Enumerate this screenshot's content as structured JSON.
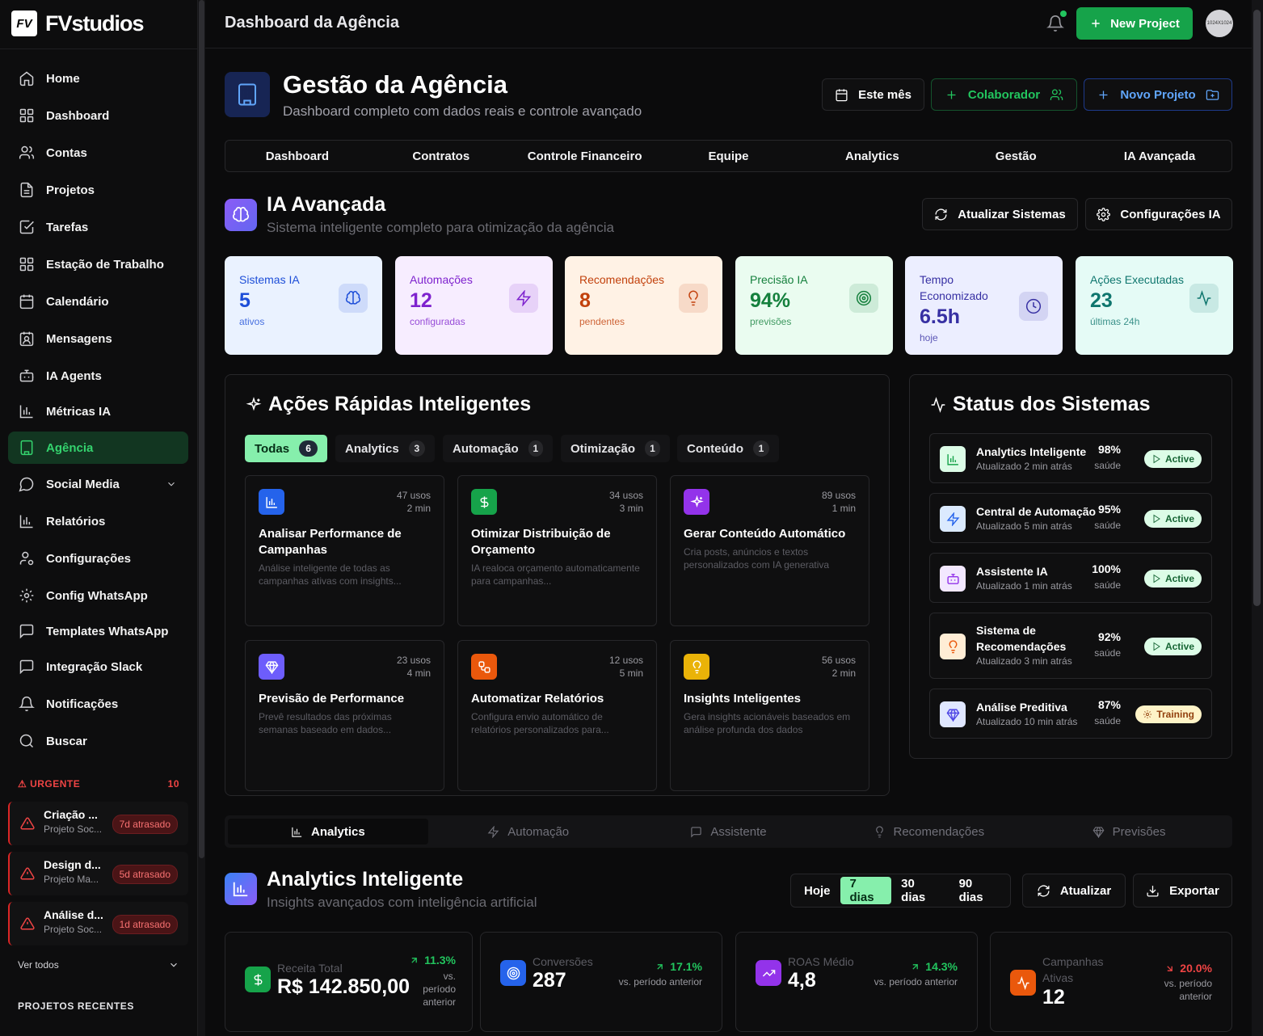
{
  "app": {
    "logo_mark": "FV",
    "logo_text": "FVstudios"
  },
  "nav": [
    {
      "label": "Home",
      "icon": "home-icon"
    },
    {
      "label": "Dashboard",
      "icon": "grid-icon"
    },
    {
      "label": "Contas",
      "icon": "users-icon"
    },
    {
      "label": "Projetos",
      "icon": "file-icon"
    },
    {
      "label": "Tarefas",
      "icon": "check-square-icon"
    },
    {
      "label": "Estação de Trabalho",
      "icon": "grid-icon"
    },
    {
      "label": "Calendário",
      "icon": "calendar-icon"
    },
    {
      "label": "Mensagens",
      "icon": "contact-icon"
    },
    {
      "label": "IA Agents",
      "icon": "bot-icon"
    },
    {
      "label": "Métricas IA",
      "icon": "bar-chart-icon"
    },
    {
      "label": "Agência",
      "icon": "building-icon",
      "active": true
    },
    {
      "label": "Social Media",
      "icon": "message-circle-icon"
    },
    {
      "label": "Relatórios",
      "icon": "bar-chart-icon"
    },
    {
      "label": "Configurações",
      "icon": "user-cog-icon"
    },
    {
      "label": "Config WhatsApp",
      "icon": "gear-icon"
    },
    {
      "label": "Templates WhatsApp",
      "icon": "message-square-icon"
    },
    {
      "label": "Integração Slack",
      "icon": "message-square-icon"
    },
    {
      "label": "Notificações",
      "icon": "bell-icon"
    },
    {
      "label": "Buscar",
      "icon": "search-icon"
    }
  ],
  "urgent": {
    "title": "URGENTE",
    "count": "10",
    "items": [
      {
        "title": "Criação ...",
        "sub": "Projeto Soc...",
        "badge": "7d atrasado"
      },
      {
        "title": "Design d...",
        "sub": "Projeto Ma...",
        "badge": "5d atrasado"
      },
      {
        "title": "Análise d...",
        "sub": "Projeto Soc...",
        "badge": "1d atrasado"
      }
    ],
    "see_all": "Ver todos"
  },
  "recent_projects": "PROJETOS RECENTES",
  "topbar": {
    "title": "Dashboard da Agência",
    "new_project": "New Project",
    "avatar": "1024X1024"
  },
  "page": {
    "title": "Gestão da Agência",
    "subtitle": "Dashboard completo com dados reais e controle avançado",
    "btn_month": "Este mês",
    "btn_colab": "Colaborador",
    "btn_novo": "Novo Projeto"
  },
  "tabs": [
    "Dashboard",
    "Contratos",
    "Controle Financeiro",
    "Equipe",
    "Analytics",
    "Gestão",
    "IA Avançada"
  ],
  "ia": {
    "title": "IA Avançada",
    "subtitle": "Sistema inteligente completo para otimização da agência",
    "btn_refresh": "Atualizar Sistemas",
    "btn_config": "Configurações IA"
  },
  "stats": [
    {
      "label": "Sistemas IA",
      "value": "5",
      "sub": "ativos",
      "color": "#1d4ed8",
      "bg": "#eaf2ff",
      "icon": "brain-icon"
    },
    {
      "label": "Automações",
      "value": "12",
      "sub": "configuradas",
      "color": "#7e22ce",
      "bg": "#f7edff",
      "icon": "zap-icon"
    },
    {
      "label": "Recomendações",
      "value": "8",
      "sub": "pendentes",
      "color": "#c2410c",
      "bg": "#fff2e5",
      "icon": "lightbulb-icon"
    },
    {
      "label": "Precisão IA",
      "value": "94%",
      "sub": "previsões",
      "color": "#15803d",
      "bg": "#eafcf0",
      "icon": "target-icon"
    },
    {
      "label": "Tempo Economizado",
      "value": "6.5h",
      "sub": "hoje",
      "color": "#3730a3",
      "bg": "#eceeff",
      "icon": "clock-icon"
    },
    {
      "label": "Ações Executadas",
      "value": "23",
      "sub": "últimas 24h",
      "color": "#0f766e",
      "bg": "#e5fbf6",
      "icon": "activity-icon"
    }
  ],
  "quick": {
    "title": "Ações Rápidas Inteligentes",
    "filters": [
      {
        "label": "Todas",
        "count": "6"
      },
      {
        "label": "Analytics",
        "count": "3"
      },
      {
        "label": "Automação",
        "count": "1"
      },
      {
        "label": "Otimização",
        "count": "1"
      },
      {
        "label": "Conteúdo",
        "count": "1"
      }
    ],
    "cards": [
      {
        "title": "Analisar Performance de Campanhas",
        "desc": "Análise inteligente de todas as campanhas ativas com insights...",
        "uses": "47 usos",
        "time": "2 min",
        "color": "#2563eb",
        "icon": "bar-chart-icon"
      },
      {
        "title": "Otimizar Distribuição de Orçamento",
        "desc": "IA realoca orçamento automaticamente para campanhas...",
        "uses": "34 usos",
        "time": "3 min",
        "color": "#16a34a",
        "icon": "dollar-icon"
      },
      {
        "title": "Gerar Conteúdo Automático",
        "desc": "Cria posts, anúncios e textos personalizados com IA generativa",
        "uses": "89 usos",
        "time": "1 min",
        "color": "#9333ea",
        "icon": "sparkles-icon"
      },
      {
        "title": "Previsão de Performance",
        "desc": "Prevê resultados das próximas semanas baseado em dados...",
        "uses": "23 usos",
        "time": "4 min",
        "color": "#6d5dfc",
        "icon": "gem-icon"
      },
      {
        "title": "Automatizar Relatórios",
        "desc": "Configura envio automático de relatórios personalizados para...",
        "uses": "12 usos",
        "time": "5 min",
        "color": "#ea580c",
        "icon": "workflow-icon"
      },
      {
        "title": "Insights Inteligentes",
        "desc": "Gera insights acionáveis baseados em análise profunda dos dados",
        "uses": "56 usos",
        "time": "2 min",
        "color": "#eab308",
        "icon": "lightbulb-icon"
      }
    ]
  },
  "systems": {
    "title": "Status dos Sistemas",
    "health_label": "saúde",
    "items": [
      {
        "name": "Analytics Inteligente",
        "updated": "Atualizado 2 min atrás",
        "pct": "98%",
        "status": "Active",
        "icon": "bar-chart-icon",
        "color": "#16a34a",
        "bg": "#dcfce7"
      },
      {
        "name": "Central de Automação",
        "updated": "Atualizado 5 min atrás",
        "pct": "95%",
        "status": "Active",
        "icon": "zap-icon",
        "color": "#2563eb",
        "bg": "#dbeafe"
      },
      {
        "name": "Assistente IA",
        "updated": "Atualizado 1 min atrás",
        "pct": "100%",
        "status": "Active",
        "icon": "bot-icon",
        "color": "#9333ea",
        "bg": "#f3e8ff"
      },
      {
        "name": "Sistema de Recomendações",
        "updated": "Atualizado 3 min atrás",
        "pct": "92%",
        "status": "Active",
        "icon": "lightbulb-icon",
        "color": "#ea580c",
        "bg": "#ffedd5"
      },
      {
        "name": "Análise Preditiva",
        "updated": "Atualizado 10 min atrás",
        "pct": "87%",
        "status": "Training",
        "icon": "gem-icon",
        "color": "#4f46e5",
        "bg": "#e0e7ff"
      }
    ]
  },
  "lower_tabs": [
    {
      "label": "Analytics",
      "icon": "bar-chart-icon"
    },
    {
      "label": "Automação",
      "icon": "zap-icon"
    },
    {
      "label": "Assistente",
      "icon": "message-square-icon"
    },
    {
      "label": "Recomendações",
      "icon": "lightbulb-icon"
    },
    {
      "label": "Previsões",
      "icon": "gem-icon"
    }
  ],
  "analytics": {
    "title": "Analytics Inteligente",
    "subtitle": "Insights avançados com inteligência artificial",
    "periods": [
      "Hoje",
      "7 dias",
      "30 dias",
      "90 dias"
    ],
    "btn_refresh": "Atualizar",
    "btn_export": "Exportar"
  },
  "kpis": [
    {
      "label": "Receita Total",
      "value": "R$ 142.850,00",
      "change": "11.3%",
      "change_sub": "vs. período anterior",
      "dir": "up",
      "color": "#16a34a",
      "icon": "dollar-icon"
    },
    {
      "label": "Conversões",
      "value": "287",
      "change": "17.1%",
      "change_sub": "vs. período anterior",
      "dir": "up",
      "color": "#2563eb",
      "icon": "target-icon"
    },
    {
      "label": "ROAS Médio",
      "value": "4,8",
      "change": "14.3%",
      "change_sub": "vs. período anterior",
      "dir": "up",
      "color": "#9333ea",
      "icon": "trending-up-icon"
    },
    {
      "label": "Campanhas Ativas",
      "value": "12",
      "change": "20.0%",
      "change_sub": "vs. período anterior",
      "dir": "down",
      "color": "#ea580c",
      "icon": "activity-icon"
    }
  ]
}
